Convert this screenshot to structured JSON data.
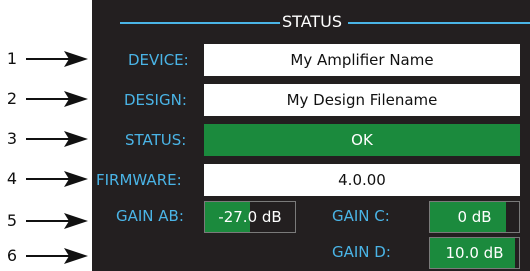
{
  "status_panel": {
    "title": "STATUS",
    "rows": {
      "device": {
        "label": "DEVICE:",
        "value": "My Amplifier Name"
      },
      "design": {
        "label": "DESIGN:",
        "value": "My Design Filename"
      },
      "status": {
        "label": "STATUS:",
        "value": "OK"
      },
      "firmware": {
        "label": "FIRMWARE:",
        "value": "4.0.00"
      }
    },
    "gains": {
      "ab": {
        "label": "GAIN AB:",
        "value": "-27.0 dB",
        "level": 0.5
      },
      "c": {
        "label": "GAIN C:",
        "value": "0 dB",
        "level": 0.85
      },
      "d": {
        "label": "GAIN D:",
        "value": "10.0 dB",
        "level": 0.95
      }
    }
  },
  "callouts": [
    "1",
    "2",
    "3",
    "4",
    "5",
    "6"
  ],
  "colors": {
    "panel_bg": "#231f20",
    "label_blue": "#4ab4e6",
    "ok_green": "#1b8a3d"
  },
  "icons": [
    "arrow-right-icon"
  ]
}
